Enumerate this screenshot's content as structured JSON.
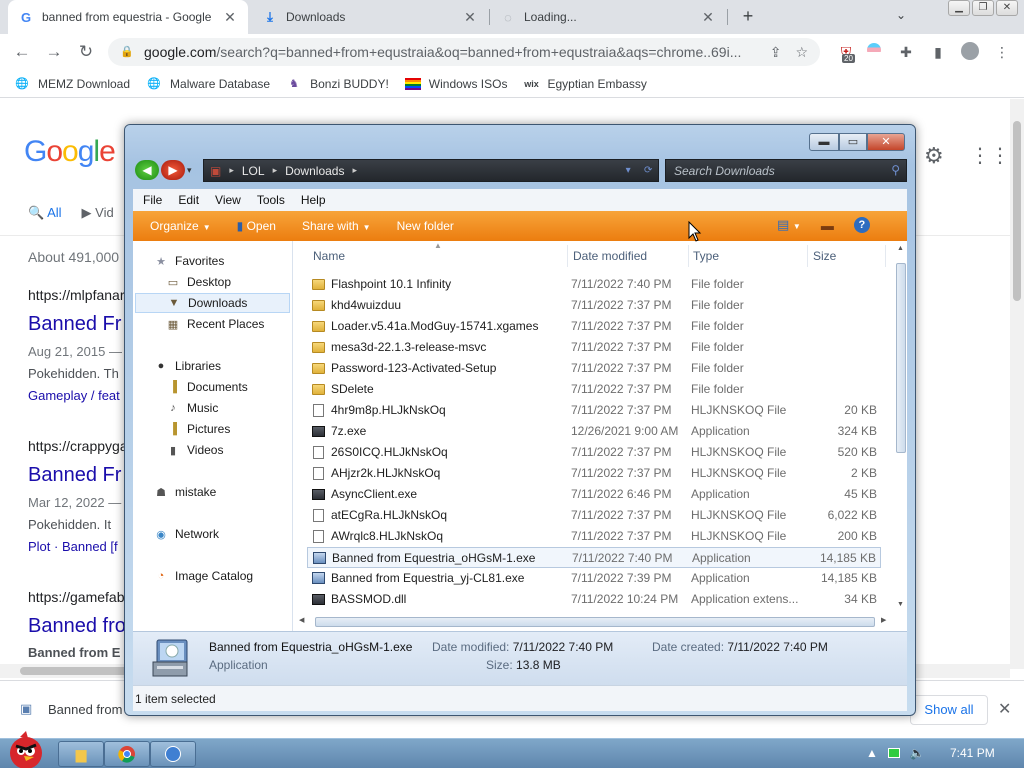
{
  "browser": {
    "tabs": [
      {
        "title": "banned from equestria - Google"
      },
      {
        "title": "Downloads"
      },
      {
        "title": "Loading..."
      }
    ],
    "url": {
      "host": "google.com",
      "rest": "/search?q=banned+from+equstraia&oq=banned+from+equstraia&aqs=chrome..69i..."
    },
    "extension_badge": "20",
    "bookmarks": [
      {
        "label": "MEMZ Download"
      },
      {
        "label": "Malware Database"
      },
      {
        "label": "Bonzi BUDDY!"
      },
      {
        "label": "Windows ISOs"
      },
      {
        "label": "Egyptian Embassy"
      }
    ]
  },
  "google": {
    "tabs": {
      "all": "All",
      "videos": "Vid"
    },
    "about": "About 491,000",
    "results": [
      {
        "cite": "https://mlpfanar",
        "title": "Banned Fr",
        "meta": "Aug 21, 2015 —",
        "snippet": "Pokehidden. Th",
        "links": "Gameplay / feat"
      },
      {
        "cite": "https://crappyga",
        "title": "Banned Fr",
        "meta": "Mar 12, 2022 —",
        "snippet": "Pokehidden. It",
        "links": "Plot · Banned [f"
      },
      {
        "cite": "https://gamefab",
        "title": "Banned fro",
        "meta": "Banned from E"
      }
    ]
  },
  "download_bar": {
    "item": "Banned from",
    "show_all": "Show all"
  },
  "explorer": {
    "address": {
      "crumb1": "LOL",
      "crumb2": "Downloads"
    },
    "search_placeholder": "Search Downloads",
    "menu": [
      "File",
      "Edit",
      "View",
      "Tools",
      "Help"
    ],
    "commands": {
      "organize": "Organize",
      "open": "Open",
      "share": "Share with",
      "new_folder": "New folder"
    },
    "sidebar": {
      "favorites": "Favorites",
      "desktop": "Desktop",
      "downloads": "Downloads",
      "recent": "Recent Places",
      "libraries": "Libraries",
      "documents": "Documents",
      "music": "Music",
      "pictures": "Pictures",
      "videos": "Videos",
      "mistake": "mistake",
      "network": "Network",
      "catalog": "Image Catalog"
    },
    "columns": {
      "name": "Name",
      "date": "Date modified",
      "type": "Type",
      "size": "Size"
    },
    "files": [
      {
        "name": "Flashpoint 10.1 Infinity",
        "date": "7/11/2022 7:40 PM",
        "type": "File folder",
        "size": "",
        "icon": "folder"
      },
      {
        "name": "khd4wuizduu",
        "date": "7/11/2022 7:37 PM",
        "type": "File folder",
        "size": "",
        "icon": "folder"
      },
      {
        "name": "Loader.v5.41a.ModGuy-15741.xgames",
        "date": "7/11/2022 7:37 PM",
        "type": "File folder",
        "size": "",
        "icon": "folder"
      },
      {
        "name": "mesa3d-22.1.3-release-msvc",
        "date": "7/11/2022 7:37 PM",
        "type": "File folder",
        "size": "",
        "icon": "folder"
      },
      {
        "name": "Password-123-Activated-Setup",
        "date": "7/11/2022 7:37 PM",
        "type": "File folder",
        "size": "",
        "icon": "folder"
      },
      {
        "name": "SDelete",
        "date": "7/11/2022 7:37 PM",
        "type": "File folder",
        "size": "",
        "icon": "folder"
      },
      {
        "name": "4hr9m8p.HLJkNskOq",
        "date": "7/11/2022 7:37 PM",
        "type": "HLJKNSKOQ File",
        "size": "20 KB",
        "icon": "file"
      },
      {
        "name": "7z.exe",
        "date": "12/26/2021 9:00 AM",
        "type": "Application",
        "size": "324 KB",
        "icon": "app"
      },
      {
        "name": "26S0ICQ.HLJkNskOq",
        "date": "7/11/2022 7:37 PM",
        "type": "HLJKNSKOQ File",
        "size": "520 KB",
        "icon": "file"
      },
      {
        "name": "AHjzr2k.HLJkNskOq",
        "date": "7/11/2022 7:37 PM",
        "type": "HLJKNSKOQ File",
        "size": "2 KB",
        "icon": "file"
      },
      {
        "name": "AsyncClient.exe",
        "date": "7/11/2022 6:46 PM",
        "type": "Application",
        "size": "45 KB",
        "icon": "app"
      },
      {
        "name": "atECgRa.HLJkNskOq",
        "date": "7/11/2022 7:37 PM",
        "type": "HLJKNSKOQ File",
        "size": "6,022 KB",
        "icon": "file"
      },
      {
        "name": "AWrqlc8.HLJkNskOq",
        "date": "7/11/2022 7:37 PM",
        "type": "HLJKNSKOQ File",
        "size": "200 KB",
        "icon": "file"
      },
      {
        "name": "Banned from Equestria_oHGsM-1.exe",
        "date": "7/11/2022 7:40 PM",
        "type": "Application",
        "size": "14,185 KB",
        "icon": "setup",
        "selected": true
      },
      {
        "name": "Banned from Equestria_yj-CL81.exe",
        "date": "7/11/2022 7:39 PM",
        "type": "Application",
        "size": "14,185 KB",
        "icon": "setup"
      },
      {
        "name": "BASSMOD.dll",
        "date": "7/11/2022 10:24 PM",
        "type": "Application extens...",
        "size": "34 KB",
        "icon": "app"
      }
    ],
    "details": {
      "name": "Banned from Equestria_oHGsM-1.exe",
      "kind": "Application",
      "modified_label": "Date modified:",
      "modified": "7/11/2022 7:40 PM",
      "created_label": "Date created:",
      "created": "7/11/2022 7:40 PM",
      "size_label": "Size:",
      "size": "13.8 MB"
    },
    "status": "1 item selected"
  },
  "taskbar": {
    "clock": "7:41 PM"
  }
}
